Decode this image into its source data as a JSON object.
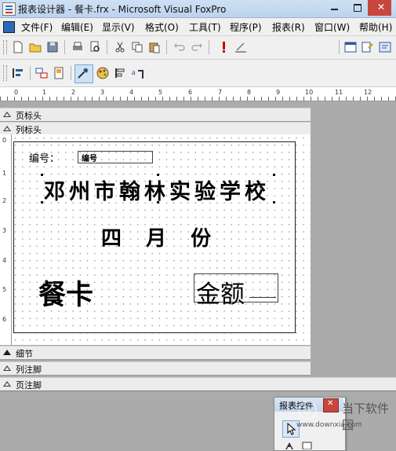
{
  "window": {
    "title": "报表设计器 - 餐卡.frx - Microsoft Visual FoxPro"
  },
  "menu": [
    "文件(F)",
    "编辑(E)",
    "显示(V)",
    "格式(O)",
    "工具(T)",
    "程序(P)",
    "报表(R)",
    "窗口(W)",
    "帮助(H)"
  ],
  "toolbar": {
    "combo_value": "",
    "icons": [
      "new-icon",
      "open-icon",
      "save-icon",
      "print-icon",
      "print-preview-icon",
      "cut-icon",
      "copy-icon",
      "paste-icon",
      "undo-icon",
      "redo-icon",
      "run-icon",
      "modify-form-icon",
      "dropdown-icon",
      "properties-icon",
      "form-designer-icon",
      "code-icon"
    ]
  },
  "toolbar2": {
    "icons": [
      "align-left-icon",
      "data-environment-icon",
      "page-setup-icon",
      "report-controls-toolbar-icon",
      "color-palette-icon",
      "layout-icon",
      "font-icon"
    ]
  },
  "ruler": {
    "h_numbers": [
      "0",
      "1",
      "2",
      "3",
      "4",
      "5",
      "6",
      "7",
      "8",
      "9",
      "10",
      "11",
      "12"
    ],
    "v_numbers": [
      "0",
      "1",
      "2",
      "3",
      "4",
      "5",
      "6"
    ]
  },
  "bands": {
    "page_header": "页标头",
    "column_header": "列标头",
    "detail": "细节",
    "column_footer": "列注脚",
    "page_footer": "页注脚"
  },
  "report": {
    "number_label": "编号：",
    "number_field": "编号",
    "school": "邓州市翰林实验学校",
    "month": "四 月 份",
    "meal_card": "餐卡",
    "amount": "金额"
  },
  "report_controls": {
    "title": "报表控件"
  },
  "watermark": {
    "text": "当下软件园",
    "url": "www.downxia.com"
  }
}
